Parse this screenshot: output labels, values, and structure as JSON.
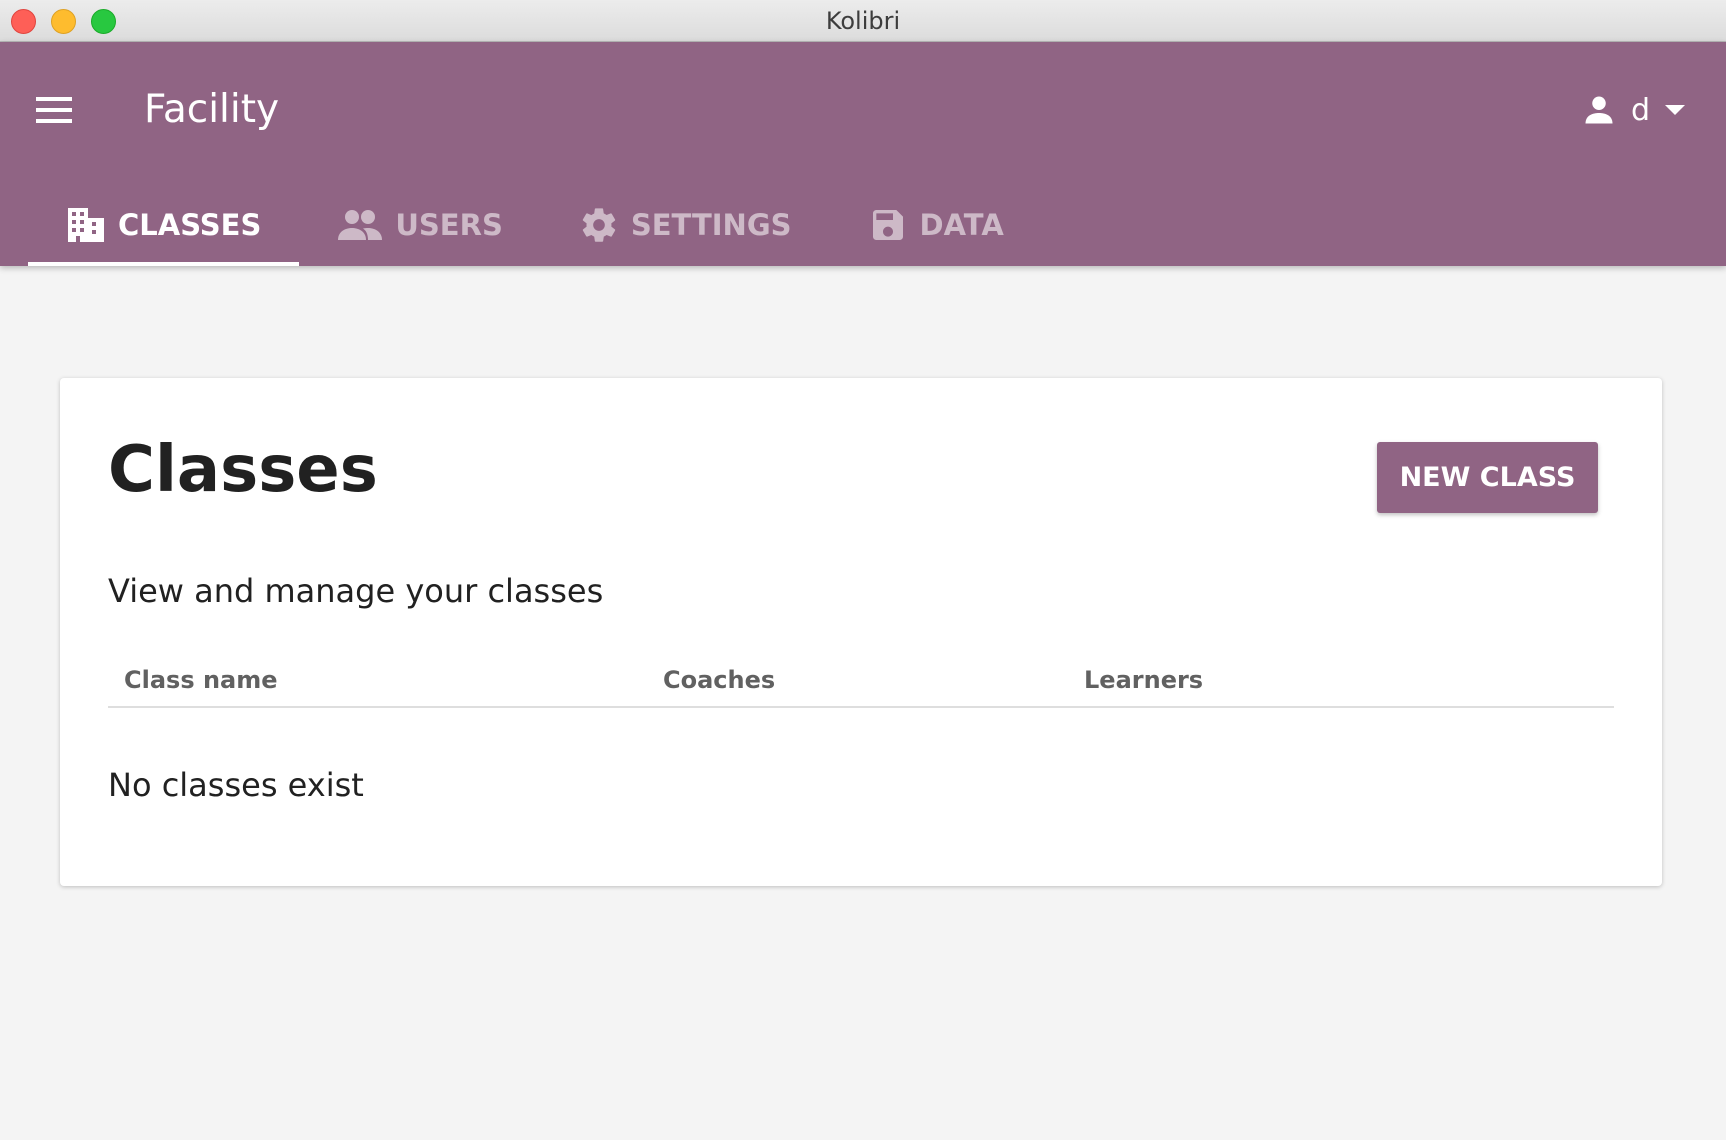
{
  "window": {
    "title": "Kolibri"
  },
  "header": {
    "title": "Facility",
    "user_label": "d"
  },
  "tabs": [
    {
      "label": "CLASSES",
      "icon": "building-icon",
      "active": true
    },
    {
      "label": "USERS",
      "icon": "people-icon",
      "active": false
    },
    {
      "label": "SETTINGS",
      "icon": "gear-icon",
      "active": false
    },
    {
      "label": "DATA",
      "icon": "save-icon",
      "active": false
    }
  ],
  "main": {
    "title": "Classes",
    "new_class_label": "NEW CLASS",
    "subtitle": "View and manage your classes",
    "table": {
      "columns": [
        "Class name",
        "Coaches",
        "Learners"
      ],
      "empty_message": "No classes exist"
    }
  },
  "colors": {
    "brand": "#906484",
    "background": "#f4f4f4"
  }
}
